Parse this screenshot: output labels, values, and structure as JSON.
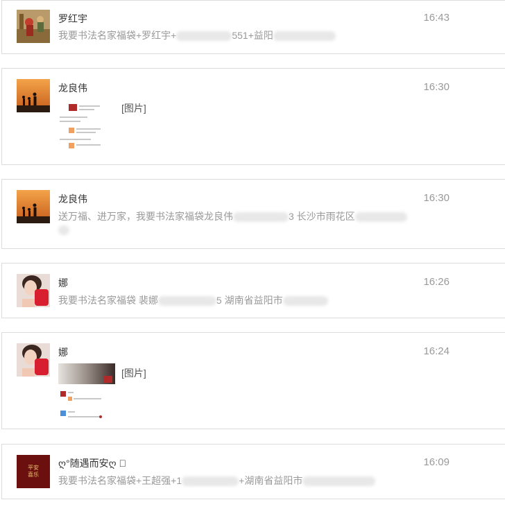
{
  "conversations": [
    {
      "name": "罗红宇",
      "time": "16:43",
      "message_start": "我要书法名家福袋+罗红宇+",
      "message_mid": "551+益阳",
      "avatar_icon": "historical-painting-avatar"
    },
    {
      "name": "龙良伟",
      "time": "16:30",
      "image_label": "[图片]",
      "avatar_icon": "sunset-silhouette-avatar"
    },
    {
      "name": "龙良伟",
      "time": "16:30",
      "message_start": "送万福、进万家，我要书法家福袋龙良伟",
      "message_mid": "3 长沙市雨花区",
      "avatar_icon": "sunset-silhouette-avatar"
    },
    {
      "name": "娜",
      "time": "16:26",
      "message_start": "我要书法名家福袋 裴娜",
      "message_mid": "5 湖南省益阳市",
      "avatar_icon": "woman-red-cup-avatar"
    },
    {
      "name": "娜",
      "time": "16:24",
      "image_label": "[图片]",
      "avatar_icon": "woman-red-cup-avatar"
    },
    {
      "name": "ღ°随遇而安ღ ゚",
      "time": "16:09",
      "message_start": "我要书法名家福袋+王超强+1",
      "message_mid": "+湖南省益阳市",
      "avatar_icon": "calligraphy-ping-an-xi-le-avatar",
      "avatar_text": "平安喜乐"
    }
  ],
  "colors": {
    "border": "#dcdcdc",
    "name_text": "#333333",
    "message_text": "#999999",
    "avatar_red": "#6b0f0f"
  }
}
